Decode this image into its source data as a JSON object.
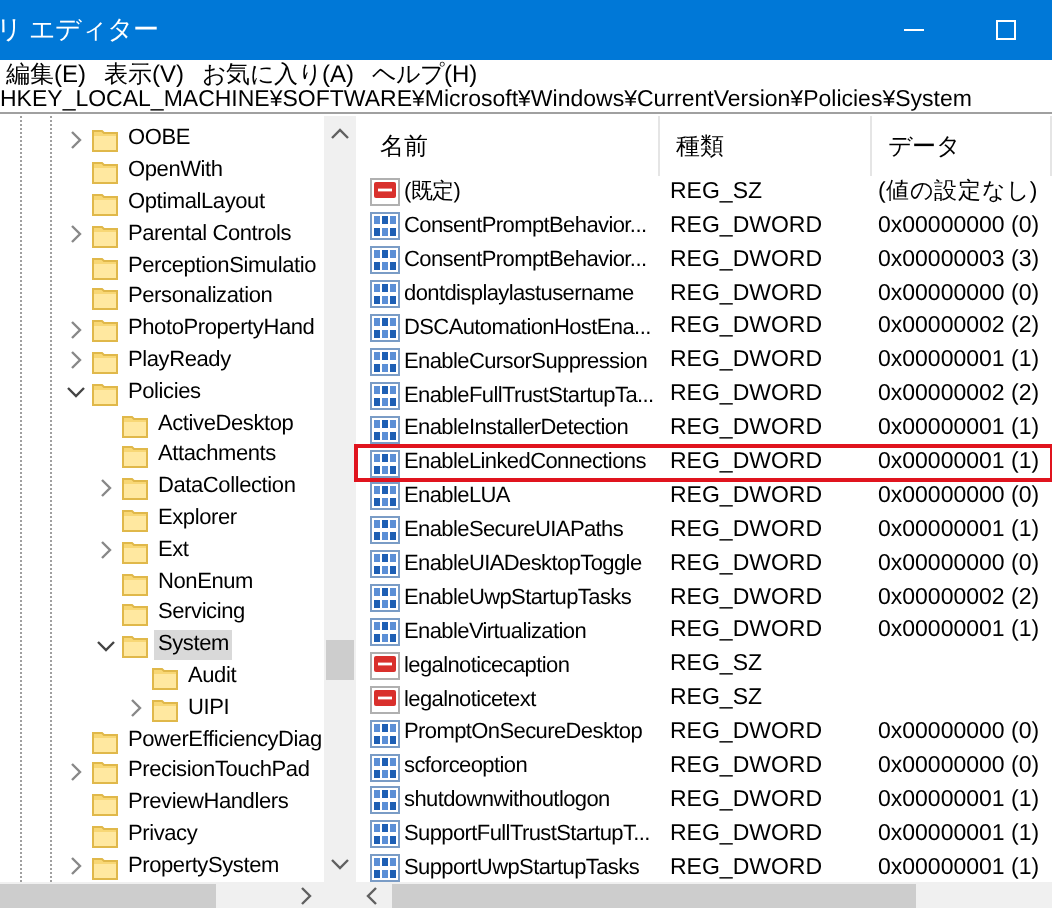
{
  "window": {
    "title": "リ エディター"
  },
  "menu": [
    "編集(E)",
    "表示(V)",
    "お気に入り(A)",
    "ヘルプ(H)"
  ],
  "address": "HKEY_LOCAL_MACHINE¥SOFTWARE¥Microsoft¥Windows¥CurrentVersion¥Policies¥System",
  "tree": [
    {
      "label": "OOBE",
      "expanded": false
    },
    {
      "label": "OpenWith"
    },
    {
      "label": "OptimalLayout"
    },
    {
      "label": "Parental Controls",
      "expanded": false
    },
    {
      "label": "PerceptionSimulatio"
    },
    {
      "label": "Personalization"
    },
    {
      "label": "PhotoPropertyHand",
      "expanded": false
    },
    {
      "label": "PlayReady",
      "expanded": false
    },
    {
      "label": "Policies",
      "expanded": true,
      "children": [
        {
          "label": "ActiveDesktop"
        },
        {
          "label": "Attachments"
        },
        {
          "label": "DataCollection",
          "expanded": false
        },
        {
          "label": "Explorer"
        },
        {
          "label": "Ext",
          "expanded": false
        },
        {
          "label": "NonEnum"
        },
        {
          "label": "Servicing"
        },
        {
          "label": "System",
          "expanded": true,
          "selected": true,
          "children": [
            {
              "label": "Audit"
            },
            {
              "label": "UIPI",
              "expanded": false
            }
          ]
        }
      ]
    },
    {
      "label": "PowerEfficiencyDiag"
    },
    {
      "label": "PrecisionTouchPad",
      "expanded": false
    },
    {
      "label": "PreviewHandlers"
    },
    {
      "label": "Privacy"
    },
    {
      "label": "PropertySystem",
      "expanded": false
    }
  ],
  "table": {
    "columns": [
      "名前",
      "種類",
      "データ"
    ],
    "rows": [
      {
        "kind": "sz",
        "name": "(既定)",
        "type": "REG_SZ",
        "data": "(値の設定なし)",
        "highlighted": false
      },
      {
        "kind": "dword",
        "name": "ConsentPromptBehavior...",
        "type": "REG_DWORD",
        "data": "0x00000000 (0)",
        "highlighted": false
      },
      {
        "kind": "dword",
        "name": "ConsentPromptBehavior...",
        "type": "REG_DWORD",
        "data": "0x00000003 (3)",
        "highlighted": false
      },
      {
        "kind": "dword",
        "name": "dontdisplaylastusername",
        "type": "REG_DWORD",
        "data": "0x00000000 (0)",
        "highlighted": false
      },
      {
        "kind": "dword",
        "name": "DSCAutomationHostEna...",
        "type": "REG_DWORD",
        "data": "0x00000002 (2)",
        "highlighted": false
      },
      {
        "kind": "dword",
        "name": "EnableCursorSuppression",
        "type": "REG_DWORD",
        "data": "0x00000001 (1)",
        "highlighted": false
      },
      {
        "kind": "dword",
        "name": "EnableFullTrustStartupTa...",
        "type": "REG_DWORD",
        "data": "0x00000002 (2)",
        "highlighted": false
      },
      {
        "kind": "dword",
        "name": "EnableInstallerDetection",
        "type": "REG_DWORD",
        "data": "0x00000001 (1)",
        "highlighted": false
      },
      {
        "kind": "dword",
        "name": "EnableLinkedConnections",
        "type": "REG_DWORD",
        "data": "0x00000001 (1)",
        "highlighted": true
      },
      {
        "kind": "dword",
        "name": "EnableLUA",
        "type": "REG_DWORD",
        "data": "0x00000000 (0)",
        "highlighted": false
      },
      {
        "kind": "dword",
        "name": "EnableSecureUIAPaths",
        "type": "REG_DWORD",
        "data": "0x00000001 (1)",
        "highlighted": false
      },
      {
        "kind": "dword",
        "name": "EnableUIADesktopToggle",
        "type": "REG_DWORD",
        "data": "0x00000000 (0)",
        "highlighted": false
      },
      {
        "kind": "dword",
        "name": "EnableUwpStartupTasks",
        "type": "REG_DWORD",
        "data": "0x00000002 (2)",
        "highlighted": false
      },
      {
        "kind": "dword",
        "name": "EnableVirtualization",
        "type": "REG_DWORD",
        "data": "0x00000001 (1)",
        "highlighted": false
      },
      {
        "kind": "sz",
        "name": "legalnoticecaption",
        "type": "REG_SZ",
        "highlighted": false
      },
      {
        "kind": "sz",
        "name": "legalnoticetext",
        "type": "REG_SZ",
        "highlighted": false
      },
      {
        "kind": "dword",
        "name": "PromptOnSecureDesktop",
        "type": "REG_DWORD",
        "data": "0x00000000 (0)",
        "highlighted": false
      },
      {
        "kind": "dword",
        "name": "scforceoption",
        "type": "REG_DWORD",
        "data": "0x00000000 (0)",
        "highlighted": false
      },
      {
        "kind": "dword",
        "name": "shutdownwithoutlogon",
        "type": "REG_DWORD",
        "data": "0x00000001 (1)",
        "highlighted": false
      },
      {
        "kind": "dword",
        "name": "SupportFullTrustStartupT...",
        "type": "REG_DWORD",
        "data": "0x00000001 (1)",
        "highlighted": false
      },
      {
        "kind": "dword",
        "name": "SupportUwpStartupTasks",
        "type": "REG_DWORD",
        "data": "0x00000001 (1)",
        "highlighted": false
      }
    ]
  }
}
